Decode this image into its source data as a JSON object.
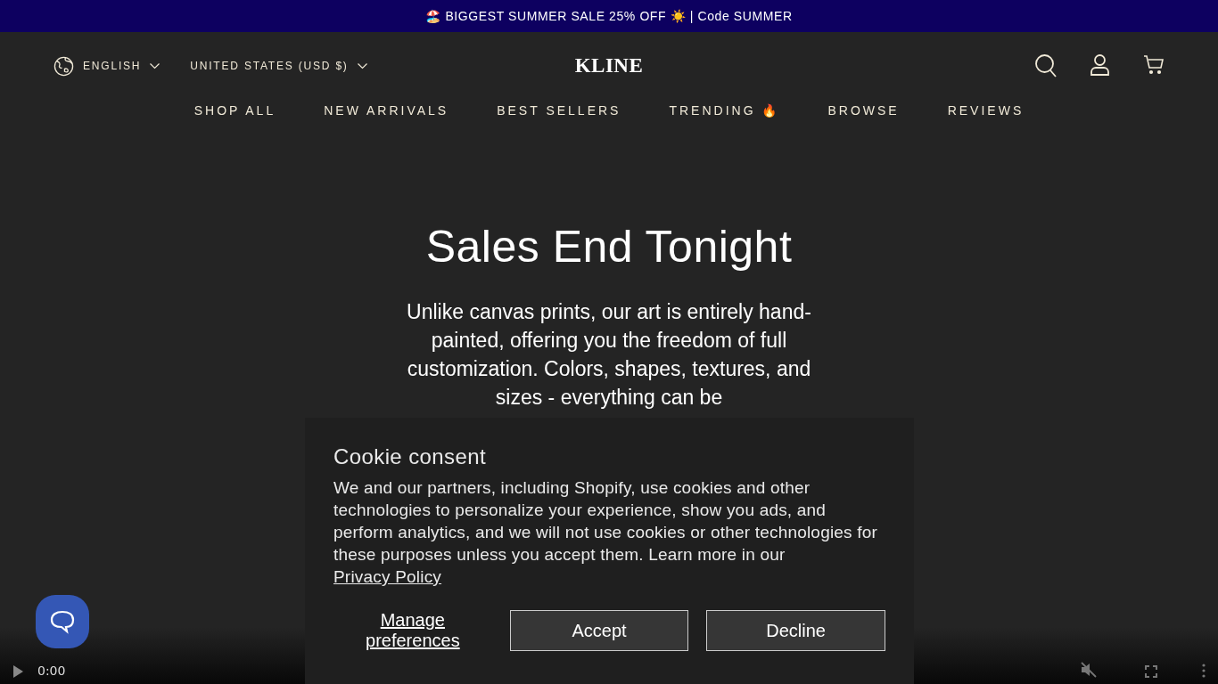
{
  "announcement": {
    "text": "🏖️ BIGGEST SUMMER SALE 25% OFF ☀️ | Code SUMMER"
  },
  "header": {
    "language": "ENGLISH",
    "currency": "UNITED STATES (USD $)",
    "logo": "KLINE"
  },
  "nav": [
    "SHOP ALL",
    "NEW ARRIVALS",
    "BEST SELLERS",
    "TRENDING 🔥",
    "BROWSE",
    "REVIEWS"
  ],
  "hero": {
    "title": "Sales End Tonight",
    "body": "Unlike canvas prints, our art is entirely hand-painted, offering you the freedom of full customization. Colors, shapes, textures, and sizes - everything can be"
  },
  "cookie": {
    "title": "Cookie consent",
    "body": "We and our partners, including Shopify, use cookies and other technologies to personalize your experience, show you ads, and perform analytics, and we will not use cookies or other technologies for these purposes unless you accept them. Learn more in our",
    "link": "Privacy Policy",
    "buttons": [
      {
        "label": "Manage preferences",
        "kind": "link"
      },
      {
        "label": "Accept",
        "kind": "outlined"
      },
      {
        "label": "Decline",
        "kind": "outlined"
      }
    ]
  },
  "video": {
    "time": "0:00",
    "muted": true
  }
}
